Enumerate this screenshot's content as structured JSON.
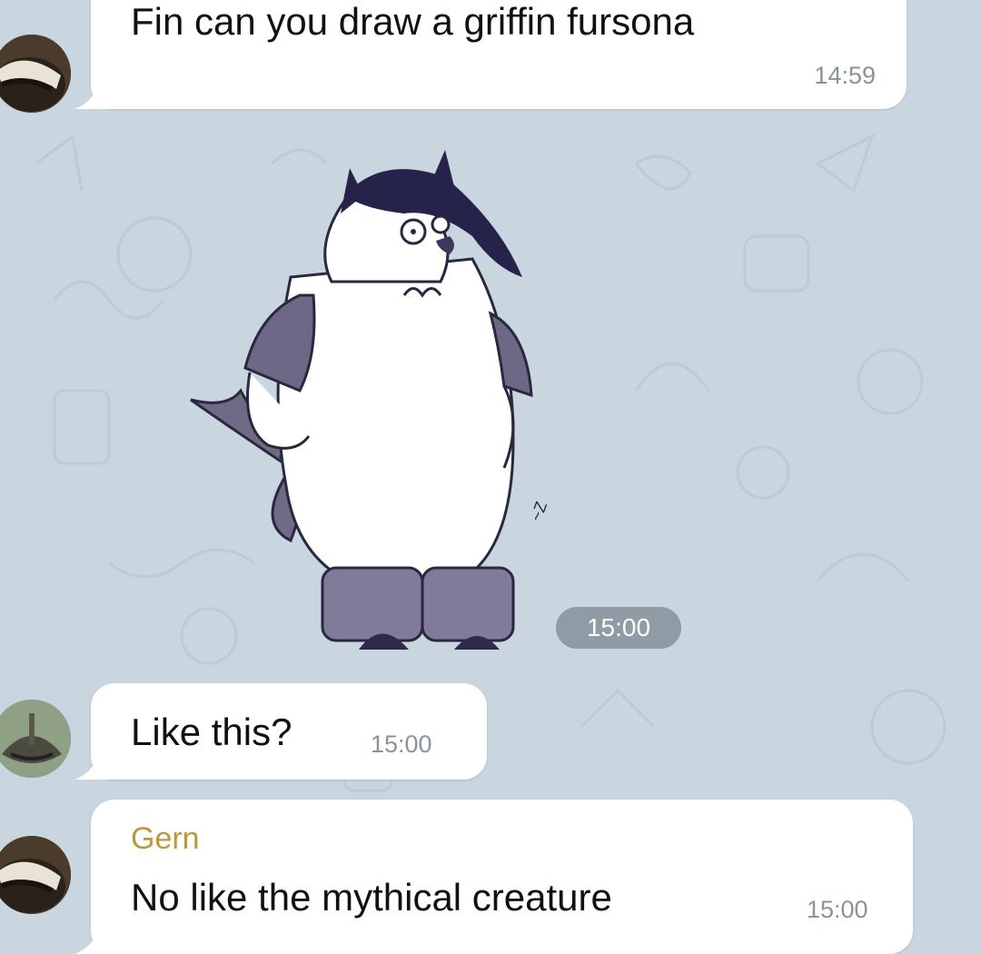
{
  "chat": {
    "messages": [
      {
        "text": "Fin can you draw a griffin fursona",
        "time": "14:59"
      },
      {
        "sticker": "cartoon-character-sticker",
        "time": "15:00"
      },
      {
        "text": "Like this?",
        "time": "15:00"
      },
      {
        "sender": "Gern",
        "text": "No like the mythical creature",
        "time": "15:00"
      }
    ]
  },
  "colors": {
    "background": "#c9d5df",
    "bubble": "#ffffff",
    "sender_name": "#b99a3a",
    "timestamp": "#8a939b",
    "sticker_time_pill": "#8f9ba5"
  },
  "icons": {
    "avatar_1": "badger-avatar",
    "avatar_2": "catfish-avatar",
    "avatar_3": "badger-avatar"
  }
}
